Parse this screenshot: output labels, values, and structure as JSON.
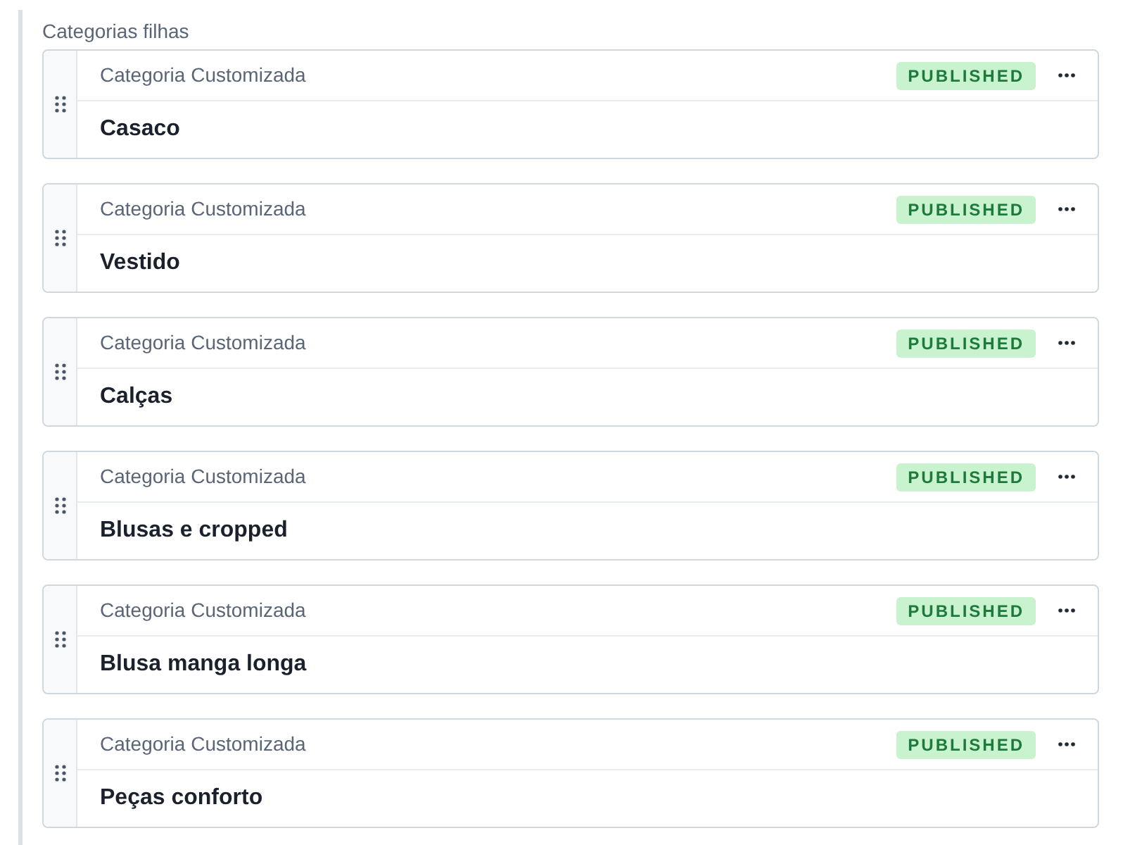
{
  "section_label": "Categorias filhas",
  "items": [
    {
      "type_label": "Categoria Customizada",
      "status": "PUBLISHED",
      "title": "Casaco"
    },
    {
      "type_label": "Categoria Customizada",
      "status": "PUBLISHED",
      "title": "Vestido"
    },
    {
      "type_label": "Categoria Customizada",
      "status": "PUBLISHED",
      "title": "Calças"
    },
    {
      "type_label": "Categoria Customizada",
      "status": "PUBLISHED",
      "title": "Blusas e cropped"
    },
    {
      "type_label": "Categoria Customizada",
      "status": "PUBLISHED",
      "title": "Blusa manga longa"
    },
    {
      "type_label": "Categoria Customizada",
      "status": "PUBLISHED",
      "title": "Peças conforto"
    }
  ]
}
